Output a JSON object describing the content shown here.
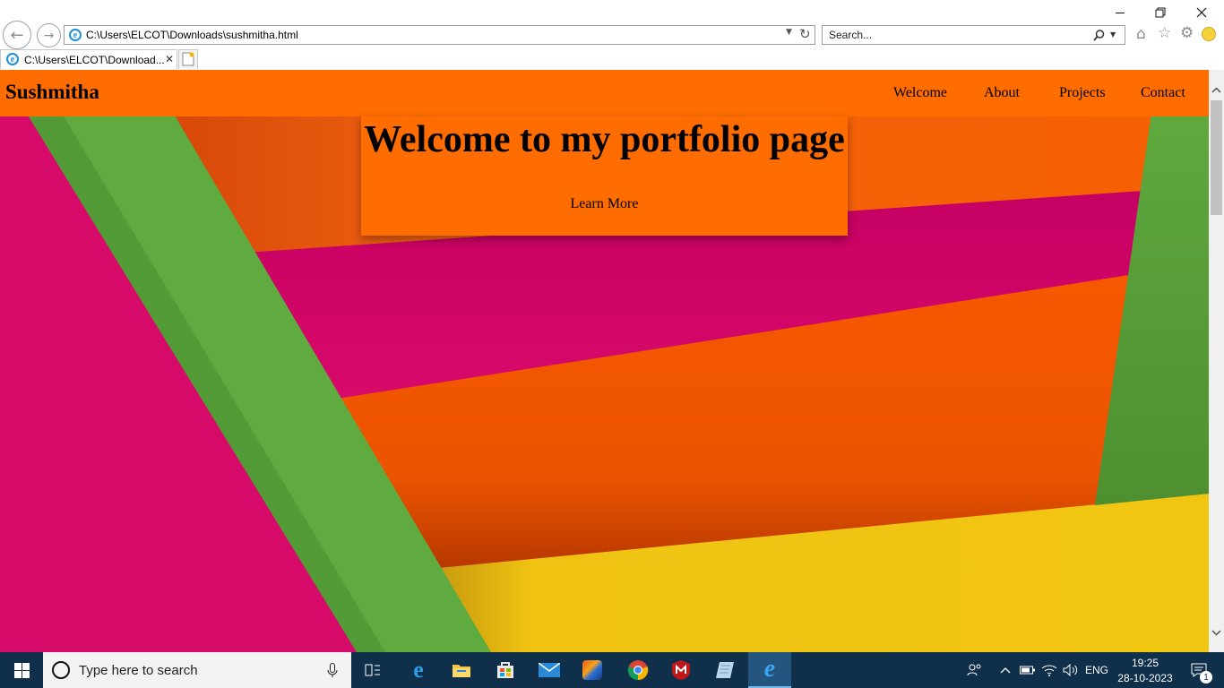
{
  "browser": {
    "address": "C:\\Users\\ELCOT\\Downloads\\sushmitha.html",
    "search_placeholder": "Search...",
    "tab_title": "C:\\Users\\ELCOT\\Download...",
    "tab_close": "✕"
  },
  "site": {
    "brand": "Sushmitha",
    "nav": [
      "Welcome",
      "About",
      "Projects",
      "Contact"
    ],
    "hero_title": "Welcome to my portfolio page",
    "hero_button": "Learn More",
    "accent_color": "#ff6d00"
  },
  "taskbar": {
    "search_placeholder": "Type here to search",
    "language": "ENG",
    "time": "19:25",
    "date": "28-10-2023",
    "notification_count": "1",
    "pinned_icons": [
      "task-view-icon",
      "edge-icon",
      "file-explorer-icon",
      "store-icon",
      "mail-icon",
      "media-player-icon",
      "chrome-icon",
      "mcafee-icon",
      "notes-icon",
      "internet-explorer-icon"
    ]
  }
}
